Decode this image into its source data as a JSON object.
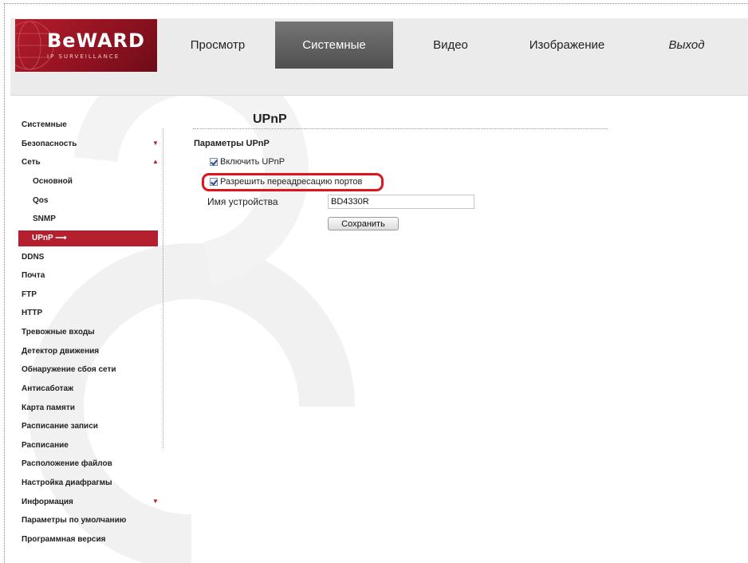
{
  "brand": {
    "logo_text": "BeWARD",
    "logo_subtext": "IP SURVEILLANCE"
  },
  "nav": {
    "tabs": [
      {
        "label": "Просмотр"
      },
      {
        "label": "Системные"
      },
      {
        "label": "Видео"
      },
      {
        "label": "Изображение"
      },
      {
        "label": "Выход"
      }
    ],
    "active": "Системные"
  },
  "sidebar": {
    "items": [
      {
        "label": "Системные"
      },
      {
        "label": "Безопасность"
      },
      {
        "label": "Сеть"
      },
      {
        "label": "Основной"
      },
      {
        "label": "Qos"
      },
      {
        "label": "SNMP"
      },
      {
        "label": "UPnP"
      },
      {
        "label": "DDNS"
      },
      {
        "label": "Почта"
      },
      {
        "label": "FTP"
      },
      {
        "label": "HTTP"
      },
      {
        "label": "Тревожные входы"
      },
      {
        "label": "Детектор движения"
      },
      {
        "label": "Обнаружение сбоя сети"
      },
      {
        "label": "Антисаботаж"
      },
      {
        "label": "Карта памяти"
      },
      {
        "label": "Расписание записи"
      },
      {
        "label": "Расписание"
      },
      {
        "label": "Расположение файлов"
      },
      {
        "label": "Настройка диафрагмы"
      },
      {
        "label": "Информация"
      },
      {
        "label": "Параметры по умолчанию"
      },
      {
        "label": "Программная версия"
      }
    ],
    "active_arrow": "⟶",
    "expand_icon": "triangle-down-icon",
    "collapse_icon": "triangle-up-icon"
  },
  "main": {
    "title": "UPnP",
    "section_title": "Параметры UPnP",
    "enable_upnp": {
      "label": "Включить UPnP",
      "checked": true
    },
    "port_forwarding": {
      "label": "Разрешить переадресацию портов",
      "checked": true
    },
    "device_name": {
      "label": "Имя устройства",
      "value": "BD4330R"
    },
    "save_label": "Сохранить"
  },
  "colors": {
    "accent": "#b4202e",
    "highlight": "#e0141b",
    "active_tab": "#5c5c5c",
    "header_bg": "#ebebeb"
  }
}
